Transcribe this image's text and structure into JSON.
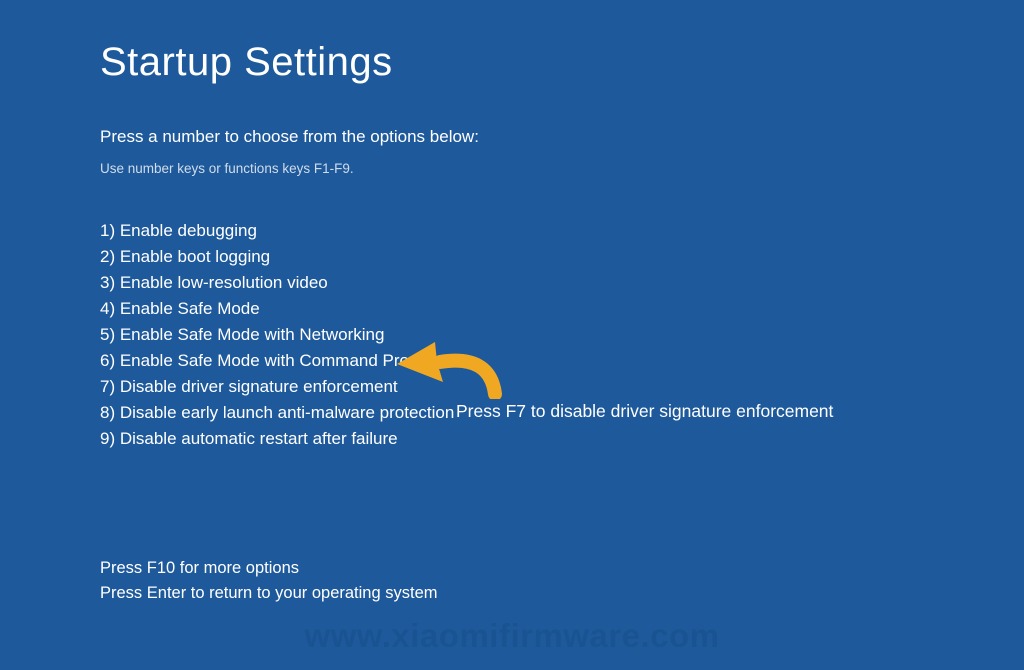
{
  "title": "Startup Settings",
  "subtitle": "Press a number to choose from the options below:",
  "hint": "Use number keys or functions keys F1-F9.",
  "options": {
    "item1": "1) Enable debugging",
    "item2": "2) Enable boot logging",
    "item3": "3) Enable low-resolution video",
    "item4": "4) Enable Safe Mode",
    "item5": "5) Enable Safe Mode with Networking",
    "item6": "6) Enable Safe Mode with Command Prompt",
    "item7": "7) Disable driver signature enforcement",
    "item8": "8) Disable early launch anti-malware protection",
    "item9": "9) Disable automatic restart after failure"
  },
  "footer": {
    "line1": "Press F10 for more options",
    "line2": "Press Enter to return to your operating system"
  },
  "annotation": {
    "text": "Press F7 to disable driver signature enforcement",
    "arrow_color": "#f0a823"
  },
  "watermark": "www.xiaomifirmware.com"
}
